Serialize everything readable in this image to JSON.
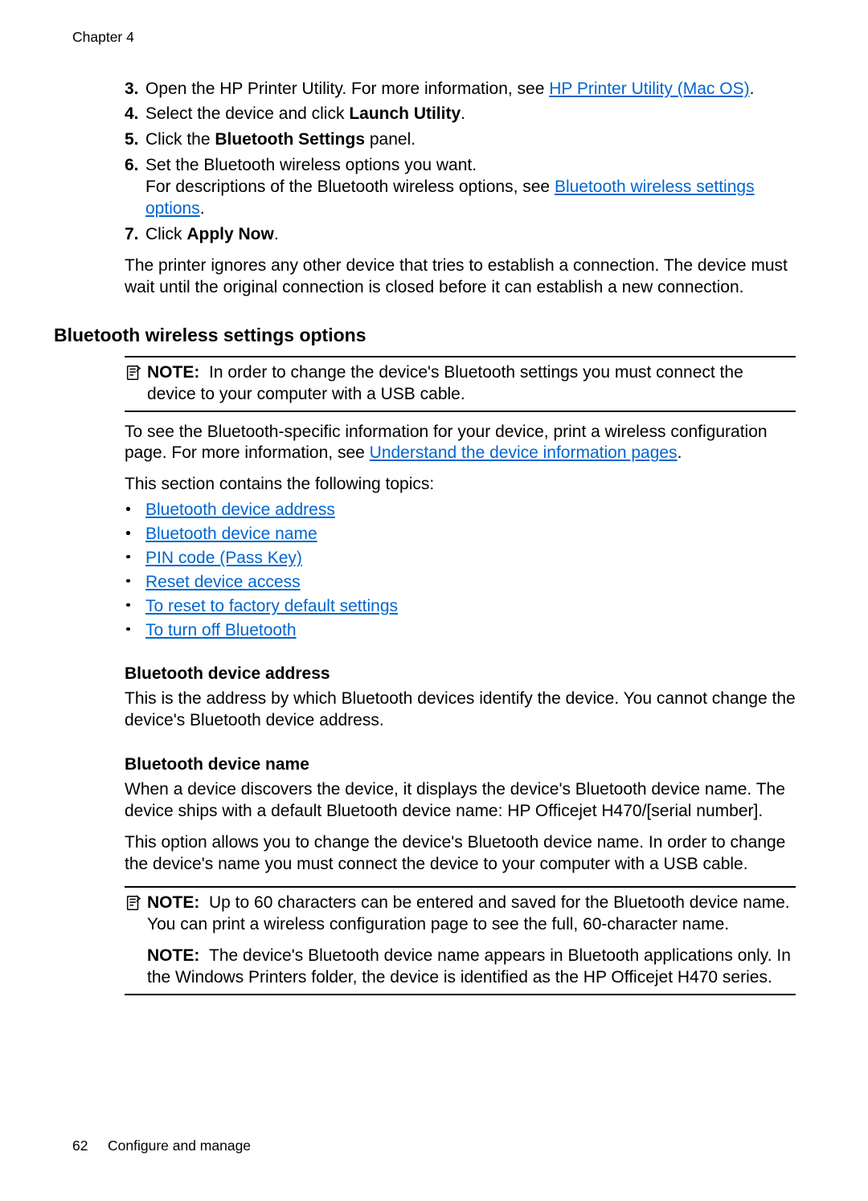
{
  "header": {
    "chapter": "Chapter 4"
  },
  "steps": {
    "s3": {
      "num": "3.",
      "lead": "Open the HP Printer Utility. For more information, see ",
      "link": "HP Printer Utility (Mac OS)",
      "tail": "."
    },
    "s4": {
      "num": "4.",
      "lead": "Select the device and click ",
      "bold": "Launch Utility",
      "tail": "."
    },
    "s5": {
      "num": "5.",
      "lead": "Click the ",
      "bold": "Bluetooth Settings",
      "tail": " panel."
    },
    "s6": {
      "num": "6.",
      "line1": "Set the Bluetooth wireless options you want.",
      "line2a": "For descriptions of the Bluetooth wireless options, see ",
      "link": "Bluetooth wireless settings options",
      "line2b": "."
    },
    "s7": {
      "num": "7.",
      "lead": "Click ",
      "bold": "Apply Now",
      "tail": "."
    }
  },
  "after_steps_para": "The printer ignores any other device that tries to establish a connection. The device must wait until the original connection is closed before it can establish a new connection.",
  "section_heading": "Bluetooth wireless settings options",
  "note1": {
    "label": "NOTE:",
    "text": "In order to change the device's Bluetooth settings you must connect the device to your computer with a USB cable."
  },
  "para_after_note1a": "To see the Bluetooth-specific information for your device, print a wireless configuration page. For more information, see ",
  "para_after_note1_link": "Understand the device information pages",
  "para_after_note1b": ".",
  "topics_intro": "This section contains the following topics:",
  "topics": [
    "Bluetooth device address",
    "Bluetooth device name",
    "PIN code (Pass Key)",
    "Reset device access",
    "To reset to factory default settings",
    "To turn off Bluetooth"
  ],
  "sub1": {
    "heading": "Bluetooth device address",
    "body": "This is the address by which Bluetooth devices identify the device. You cannot change the device's Bluetooth device address."
  },
  "sub2": {
    "heading": "Bluetooth device name",
    "p1": "When a device discovers the device, it displays the device's Bluetooth device name. The device ships with a default Bluetooth device name: HP Officejet H470/[serial number].",
    "p2": "This option allows you to change the device's Bluetooth device name. In order to change the device's name you must connect the device to your computer with a USB cable."
  },
  "note2a": {
    "label": "NOTE:",
    "text": "Up to 60 characters can be entered and saved for the Bluetooth device name. You can print a wireless configuration page to see the full, 60-character name."
  },
  "note2b": {
    "label": "NOTE:",
    "text": "The device's Bluetooth device name appears in Bluetooth applications only. In the Windows Printers folder, the device is identified as the HP Officejet H470 series."
  },
  "footer": {
    "page": "62",
    "title": "Configure and manage"
  }
}
